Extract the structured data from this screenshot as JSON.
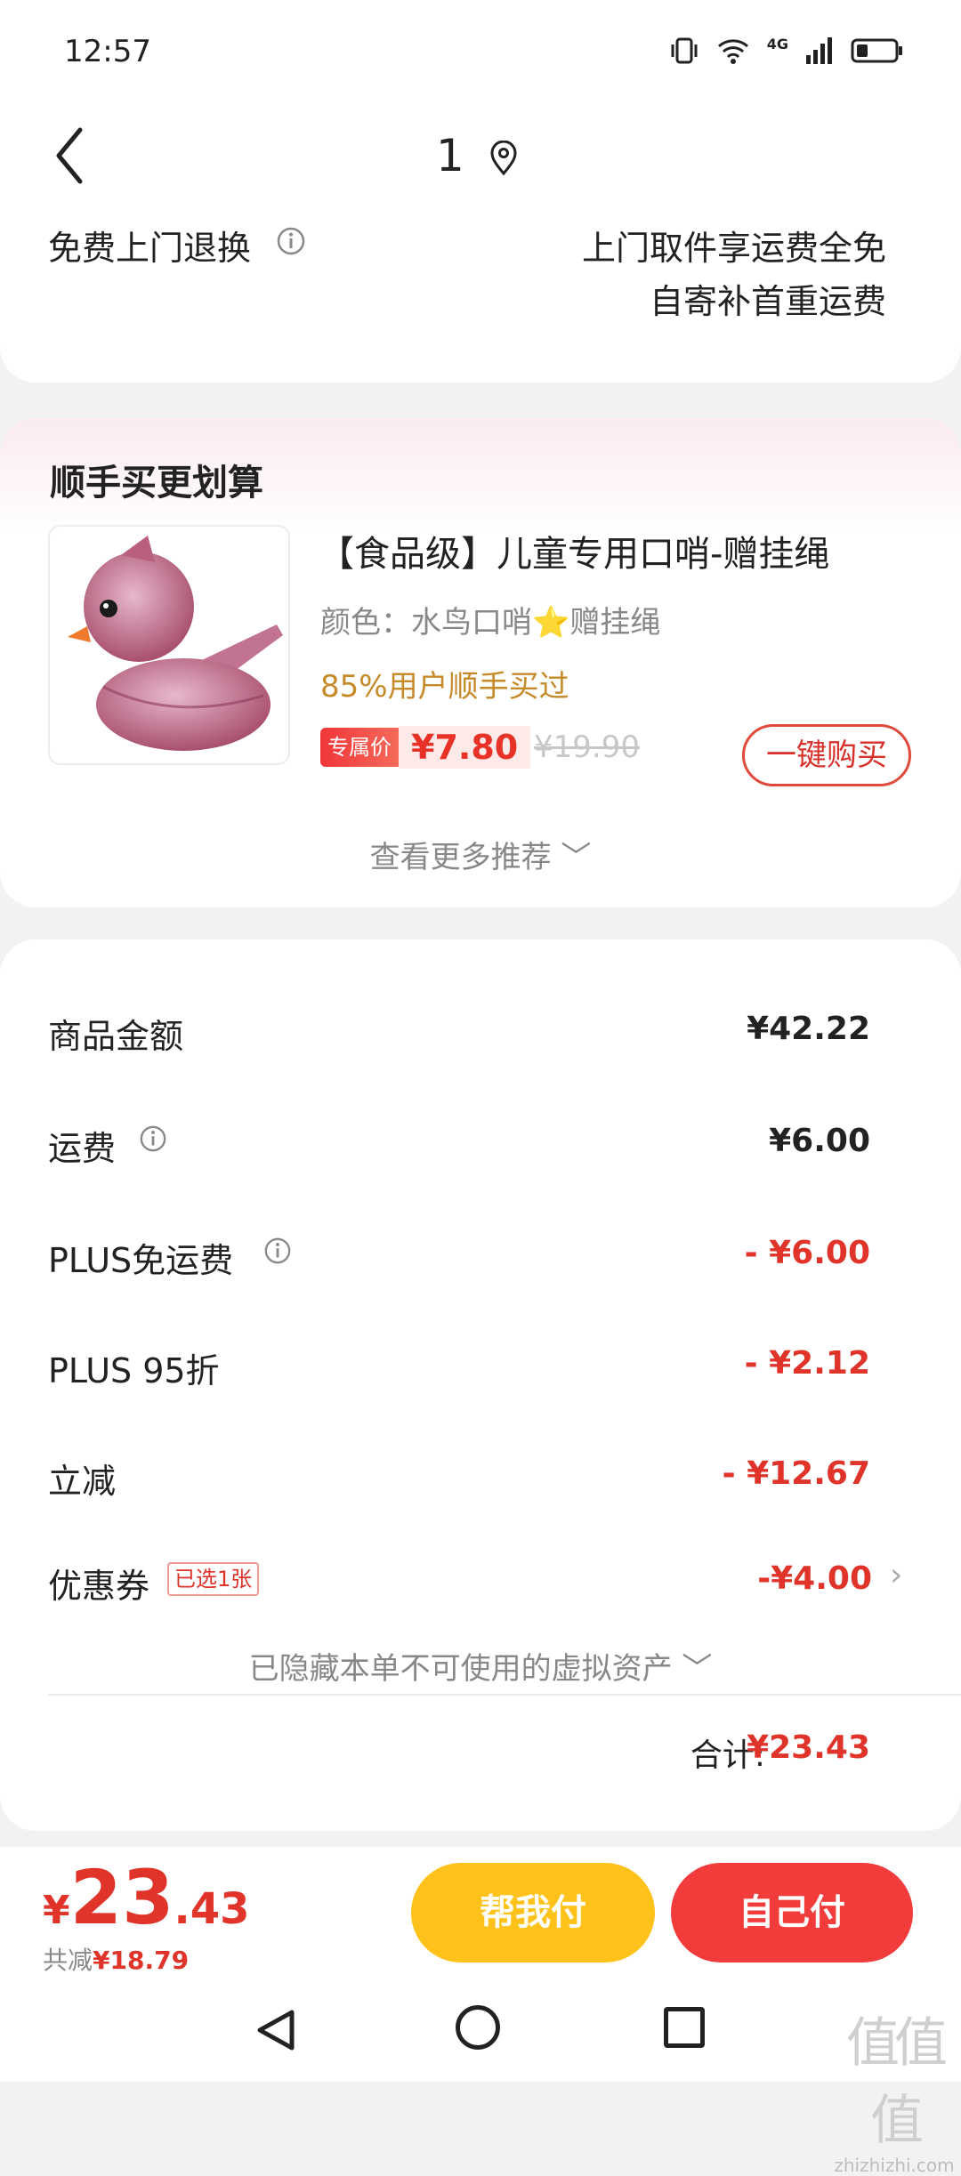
{
  "status_bar": {
    "time": "12:57",
    "network": "4G"
  },
  "header": {
    "title": "1"
  },
  "return_policy": {
    "label": "免费上门退换",
    "line1": "上门取件享运费全免",
    "line2": "自寄补首重运费"
  },
  "recommend": {
    "title": "顺手买更划算",
    "product": {
      "name": "【食品级】儿童专用口哨-赠挂绳",
      "variant": "颜色：水鸟口哨⭐赠挂绳",
      "social_proof": "85%用户顺手买过",
      "price_tag_label": "专属价",
      "price": "¥7.80",
      "original_price": "¥19.90"
    },
    "buy_button": "一键购买",
    "more": "查看更多推荐 ﹀"
  },
  "summary": {
    "rows": [
      {
        "label": "商品金额",
        "value": "¥42.22"
      },
      {
        "label": "运费",
        "value": "¥6.00"
      },
      {
        "label": "PLUS免运费",
        "value": "- ¥6.00"
      },
      {
        "label": "PLUS 95折",
        "value": "- ¥2.12"
      },
      {
        "label": "立减",
        "value": "- ¥12.67"
      },
      {
        "label": "优惠券",
        "value": "-¥4.00",
        "badge": "已选1张"
      }
    ],
    "hidden_assets": "已隐藏本单不可使用的虚拟资产 ﹀",
    "total_label": "合计:",
    "total_value": "¥23.43"
  },
  "bottom_bar": {
    "currency": "¥",
    "amount_int": "23",
    "amount_dec": ".43",
    "saved_label": "共减",
    "saved_value": "¥18.79",
    "help_pay": "帮我付",
    "self_pay": "自己付"
  },
  "watermark": {
    "mark": "值值值",
    "text": "zhizhizhi.com"
  },
  "colors": {
    "accent_red": "#e0342a",
    "yellow": "#ffc21a",
    "gold_text": "#c68a28"
  }
}
